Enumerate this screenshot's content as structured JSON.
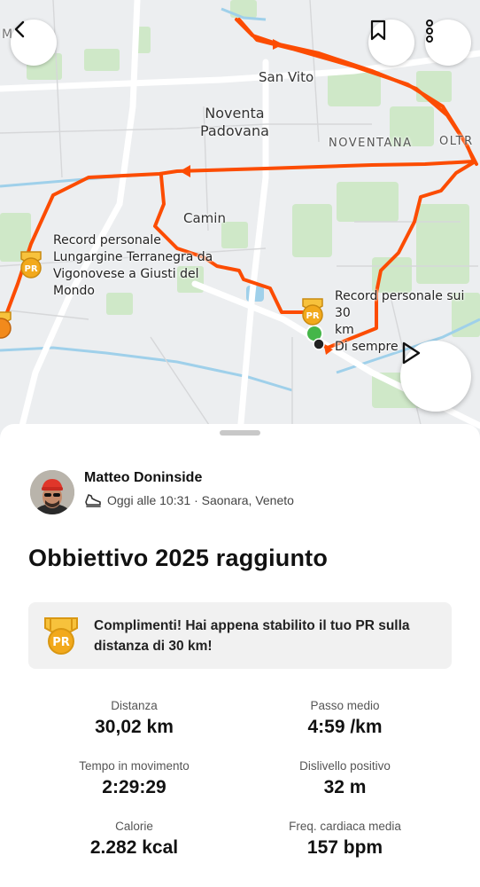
{
  "map": {
    "labels": {
      "san_vito": "San Vito",
      "noventa_padovana": "Noventa\nPadovana",
      "noventana": "NOVENTANA",
      "oltre": "OLTR",
      "camin": "Camin",
      "top_left": "M  SE"
    },
    "pr_marker_label": "PR",
    "pr_left_caption": "Record personale\nLungargine Terranegra da\nVigonovese a Giusti del\nMondo",
    "pr_right_caption": "Record personale sui 30\nkm\nDi sempre",
    "route_color": "#fc4c02"
  },
  "buttons": {
    "back": "back",
    "bookmark": "bookmark",
    "more": "more",
    "play": "play"
  },
  "athlete": {
    "name": "Matteo Doninside",
    "meta": "Oggi alle 10:31 · Saonara, Veneto"
  },
  "activity": {
    "title": "Obbiettivo 2025 raggiunto"
  },
  "pr_banner": {
    "badge_label": "PR",
    "text": "Complimenti! Hai appena stabilito il tuo PR sulla distanza di 30 km!"
  },
  "stats": [
    {
      "label": "Distanza",
      "value": "30,02 km"
    },
    {
      "label": "Passo medio",
      "value": "4:59 /km"
    },
    {
      "label": "Tempo in movimento",
      "value": "2:29:29"
    },
    {
      "label": "Dislivello positivo",
      "value": "32 m"
    },
    {
      "label": "Calorie",
      "value": "2.282 kcal"
    },
    {
      "label": "Freq. cardiaca media",
      "value": "157 bpm"
    }
  ],
  "colors": {
    "accent": "#fc4c02",
    "pr_gold": "#f2a91c"
  }
}
